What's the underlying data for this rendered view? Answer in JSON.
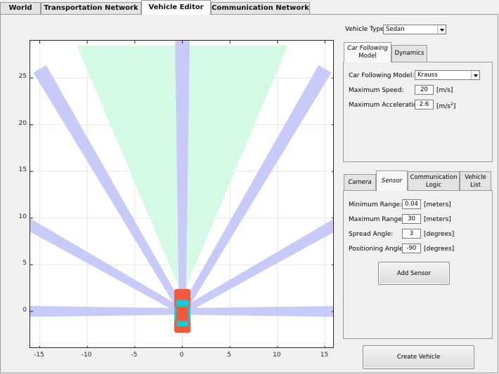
{
  "tabs": [
    "World",
    "Transportation Network",
    "Vehicle Editor",
    "Communication Network"
  ],
  "vehicle_type": {
    "label": "Vehicle Type",
    "value": "Sedan"
  },
  "model_tabs": {
    "car_following": [
      "Car Following",
      "Model"
    ],
    "dynamics": "Dynamics"
  },
  "car_following": {
    "model_label": "Car Following Model:",
    "model_value": "Krauss",
    "max_speed_label": "Maximum Speed:",
    "max_speed_value": "20",
    "max_speed_unit": "[m/s]",
    "max_accel_label": "Maximum Acceleration:",
    "max_accel_value": "2.6",
    "max_accel_unit": "[m/s",
    "max_accel_unit_sup": "2",
    "max_accel_unit_end": "]"
  },
  "sensor_tabs": {
    "camera": "Camera",
    "sensor": "Sensor",
    "comm_logic": [
      "Communication",
      "Logic"
    ],
    "vehicle_list": [
      "Vehicle",
      "List"
    ]
  },
  "sensor": {
    "min_range_label": "Minimum Range:",
    "min_range_value": "0.04",
    "min_range_unit": "[meters]",
    "max_range_label": "Maximum Range:",
    "max_range_value": "30",
    "max_range_unit": "[meters]",
    "spread_label": "Spread Angle:",
    "spread_value": "3",
    "spread_unit": "[degrees]",
    "pos_label": "Positioning Angle:",
    "pos_value": "-90",
    "pos_unit": "[degrees]",
    "add_button": "Add Sensor"
  },
  "create_button": "Create Vehicle",
  "colors": {
    "camera_fov": "#d4fae6",
    "sensor_beam": "#c8caf7",
    "car_body": "#f05a3c",
    "car_glass": "#1ec8d2"
  },
  "plot": {
    "xlim": [
      -16,
      16
    ],
    "ylim": [
      -4,
      29
    ],
    "xticks": [
      "-15",
      "-10",
      "-5",
      "0",
      "5",
      "10",
      "15"
    ],
    "xtick_values": [
      -15,
      -10,
      -5,
      0,
      5,
      10,
      15
    ],
    "yticks": [
      "0",
      "5",
      "10",
      "15",
      "20",
      "25"
    ],
    "ytick_values": [
      0,
      5,
      10,
      15,
      20,
      25
    ],
    "grid": true,
    "camera_fov": {
      "origin": [
        0,
        1.7
      ],
      "range": 29,
      "half_angle_deg": 22.5
    },
    "sensor_beams_deg": [
      0,
      30,
      60,
      90,
      120,
      150,
      180
    ],
    "sensor_spread_deg": 3,
    "sensor_range": 30
  }
}
